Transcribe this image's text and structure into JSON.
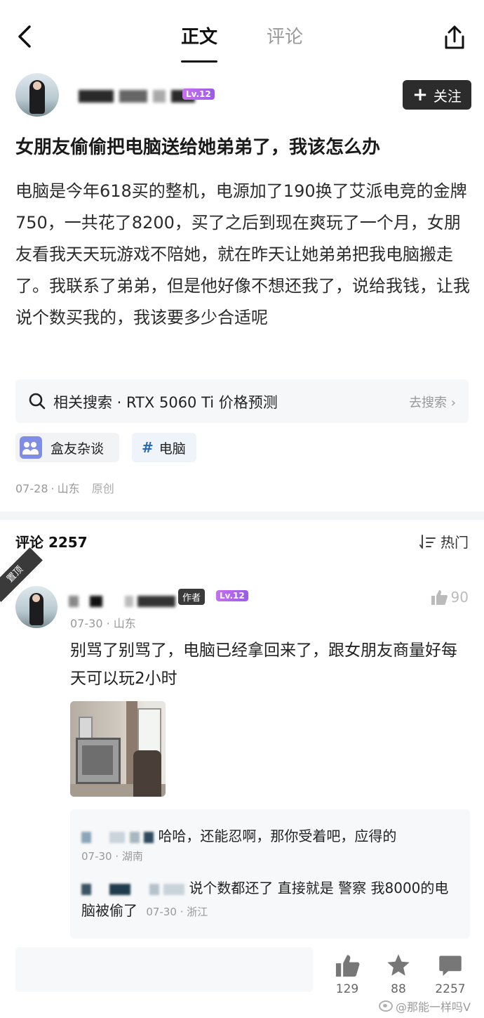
{
  "topbar": {
    "tab_main": "正文",
    "tab_comments": "评论"
  },
  "author": {
    "level": "Lv.12",
    "follow_label": "关注"
  },
  "post": {
    "title": "女朋友偷偷把电脑送给她弟弟了，我该怎么办",
    "body": "电脑是今年618买的整机，电源加了190换了艾派电竞的金牌750，一共花了8200，买了之后到现在爽玩了一个月，女朋友看我天天玩游戏不陪她，就在昨天让她弟弟把我电脑搬走了。我联系了弟弟，但是他好像不想还我了，说给我钱，让我说个数买我的，我该要多少合适呢",
    "related_search": "相关搜索 · RTX 5060 Ti 价格预测",
    "related_go": "去搜索",
    "group_chip": "盒友杂谈",
    "topic_chip": "电脑",
    "date": "07-28",
    "location": "山东",
    "original": "原创"
  },
  "comments": {
    "title": "评论 2257",
    "sort_label": "热门",
    "pinned_label": "置顶",
    "top": {
      "author_tag": "作者",
      "level": "Lv.12",
      "likes": "90",
      "date": "07-30",
      "location": "山东",
      "text": "别骂了别骂了，电脑已经拿回来了，跟女朋友商量好每天可以玩2小时"
    },
    "replies": [
      {
        "text": "哈哈，还能忍啊，那你受着吧，应得的",
        "date": "07-30",
        "location": "湖南"
      },
      {
        "text": "说个数都还了 直接就是 警察 我8000的电脑被偷了",
        "date": "07-30",
        "location": "浙江"
      }
    ]
  },
  "bottom": {
    "likes": "129",
    "favorites": "88",
    "comments": "2257"
  },
  "watermark": "@那能一样吗V"
}
